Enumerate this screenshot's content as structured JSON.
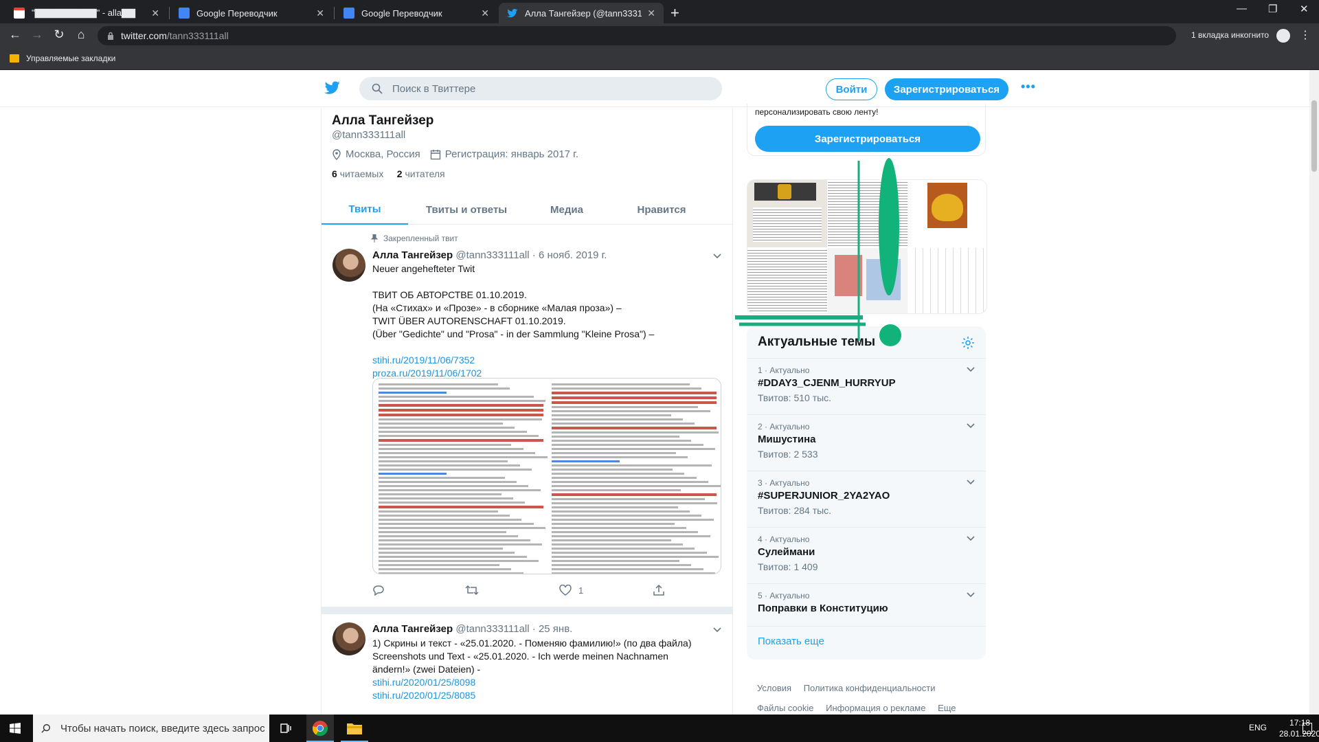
{
  "browser": {
    "tabs": [
      {
        "title": "\"▇▇▇▇▇▇▇▇▇\" - alla▇▇",
        "icon": "gmail-icon"
      },
      {
        "title": "Google Переводчик",
        "icon": "google-translate-icon"
      },
      {
        "title": "Google Переводчик",
        "icon": "google-translate-icon"
      },
      {
        "title": "Алла Тангейзер (@tann333111all)",
        "icon": "twitter-icon"
      }
    ],
    "url_host": "twitter.com",
    "url_path": "/tann333111all",
    "incognito_label": "1 вкладка инкогнито",
    "bookmarks_folder": "Управляемые закладки"
  },
  "twitter": {
    "search_placeholder": "Поиск в Твиттере",
    "login_label": "Войти",
    "signup_label": "Зарегистрироваться",
    "brand_color": "#1da1f2"
  },
  "profile": {
    "name": "Алла Тангейзер",
    "handle": "@tann333111all",
    "location": "Москва, Россия",
    "joined": "Регистрация: январь 2017 г.",
    "following_count": "6",
    "following_label": "читаемых",
    "followers_count": "2",
    "followers_label": "читателя",
    "tabs": [
      "Твиты",
      "Твиты и ответы",
      "Медиа",
      "Нравится"
    ]
  },
  "tweets": [
    {
      "pinned_label": "Закрепленный твит",
      "name": "Алла Тангейзер",
      "handle": "@tann333111all",
      "date": "· 6 нояб. 2019 г.",
      "line1": "Neuer angehefteter Twit",
      "line2": "ТВИТ ОБ АВТОРСТВЕ 01.10.2019.",
      "line3": "(На «Стихах» и «Прозе» - в сборнике «Малая проза») –",
      "line4": "TWIT ÜBER AUTORENSCHAFT 01.10.2019.",
      "line5": "(Über \"Gedichte\" und \"Prosa\" - in der Sammlung \"Kleine Prosa\") –",
      "link1": "stihi.ru/2019/11/06/7352",
      "link2": "proza.ru/2019/11/06/1702",
      "likes": "1"
    },
    {
      "name": "Алла Тангейзер",
      "handle": "@tann333111all",
      "date": "· 25 янв.",
      "line1": "1) Скрины и текст - «25.01.2020. - Поменяю фамилию!» (по два файла)",
      "line2": "Screenshots und Text - «25.01.2020. - Ich werde meinen Nachnamen",
      "line3": "ändern!» (zwei Dateien) -",
      "link1": "stihi.ru/2020/01/25/8098",
      "link2": "stihi.ru/2020/01/25/8085"
    }
  ],
  "sidebar": {
    "signup_text": "персонализировать свою ленту!",
    "signup_button": "Зарегистрироваться",
    "trends_title": "Актуальные темы",
    "trends": [
      {
        "meta": "1 · Актуально",
        "name": "#DDAY3_CJENM_HURRYUP",
        "count": "Твитов: 510 тыс."
      },
      {
        "meta": "2 · Актуально",
        "name": "Мишустина",
        "count": "Твитов: 2 533"
      },
      {
        "meta": "3 · Актуально",
        "name": "#SUPERJUNIOR_2YA2YAO",
        "count": "Твитов: 284 тыс."
      },
      {
        "meta": "4 · Актуально",
        "name": "Сулеймани",
        "count": "Твитов: 1 409"
      },
      {
        "meta": "5 · Актуально",
        "name": "Поправки в Конституцию",
        "count": ""
      }
    ],
    "show_more": "Показать еще",
    "footer": [
      "Условия",
      "Политика конфиденциальности",
      "Файлы cookie",
      "Информация о рекламе",
      "Еще"
    ]
  },
  "taskbar": {
    "search_placeholder": "Чтобы начать поиск, введите здесь запрос",
    "lang": "ENG",
    "time": "17:18",
    "date": "28.01.2020"
  }
}
